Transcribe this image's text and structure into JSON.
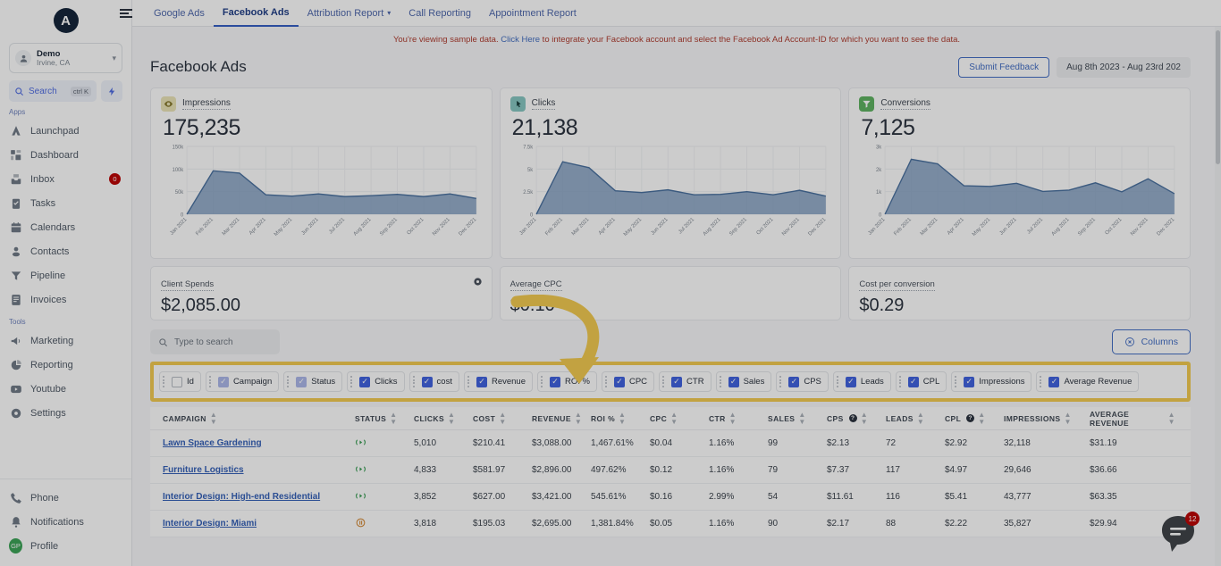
{
  "sidebar": {
    "logo_letter": "A",
    "account": {
      "name": "Demo",
      "location": "Irvine, CA"
    },
    "search": {
      "label": "Search",
      "shortcut": "ctrl K"
    },
    "sections": [
      {
        "label": "Apps",
        "items": [
          {
            "label": "Launchpad",
            "icon": "launchpad-icon",
            "badge": ""
          },
          {
            "label": "Dashboard",
            "icon": "dashboard-icon",
            "badge": ""
          },
          {
            "label": "Inbox",
            "icon": "inbox-icon",
            "badge": "0"
          },
          {
            "label": "Tasks",
            "icon": "tasks-icon",
            "badge": ""
          },
          {
            "label": "Calendars",
            "icon": "calendar-icon",
            "badge": ""
          },
          {
            "label": "Contacts",
            "icon": "contacts-icon",
            "badge": ""
          },
          {
            "label": "Pipeline",
            "icon": "pipeline-icon",
            "badge": ""
          },
          {
            "label": "Invoices",
            "icon": "invoices-icon",
            "badge": ""
          }
        ]
      },
      {
        "label": "Tools",
        "items": [
          {
            "label": "Marketing",
            "icon": "megaphone-icon",
            "badge": ""
          },
          {
            "label": "Reporting",
            "icon": "pie-chart-icon",
            "badge": ""
          },
          {
            "label": "Youtube",
            "icon": "youtube-icon",
            "badge": ""
          },
          {
            "label": "Settings",
            "icon": "gear-icon",
            "badge": ""
          }
        ]
      }
    ],
    "bottom": [
      {
        "label": "Phone",
        "icon": "phone-icon"
      },
      {
        "label": "Notifications",
        "icon": "bell-icon"
      },
      {
        "label": "Profile",
        "icon": "avatar",
        "initials": "GP"
      }
    ]
  },
  "topbar": {
    "tabs": [
      {
        "label": "Google Ads",
        "active": false,
        "caret": false
      },
      {
        "label": "Facebook Ads",
        "active": true,
        "caret": false
      },
      {
        "label": "Attribution Report",
        "active": false,
        "caret": true
      },
      {
        "label": "Call Reporting",
        "active": false,
        "caret": false
      },
      {
        "label": "Appointment Report",
        "active": false,
        "caret": false
      }
    ]
  },
  "notice": {
    "before": "You're viewing sample data. ",
    "link": "Click Here",
    "after": " to integrate your Facebook account and select the Facebook Ad Account-ID for which you want to see the data."
  },
  "header": {
    "title": "Facebook Ads",
    "feedback_label": "Submit Feedback",
    "date_range": "Aug 8th 2023 - Aug 23rd 202"
  },
  "kpis": [
    {
      "label": "Impressions",
      "value": "175,235",
      "icon": "eye-icon",
      "icon_bg": "#ece5b0",
      "icon_color": "#8a7a20"
    },
    {
      "label": "Clicks",
      "value": "21,138",
      "icon": "cursor-click-icon",
      "icon_bg": "#7ec9c3",
      "icon_color": "#14413e"
    },
    {
      "label": "Conversions",
      "value": "7,125",
      "icon": "funnel-icon",
      "icon_bg": "#55b758",
      "icon_color": "#ffffff"
    }
  ],
  "small_cards": [
    {
      "label": "Client Spends",
      "value": "$2,085.00",
      "gear": true
    },
    {
      "label": "Average CPC",
      "value": "$0.10",
      "gear": false
    },
    {
      "label": "Cost per conversion",
      "value": "$0.29",
      "gear": false
    }
  ],
  "toolbar": {
    "search_placeholder": "Type to search",
    "search_value": "",
    "columns_label": "Columns"
  },
  "column_chips": [
    {
      "label": "Id",
      "checked": false,
      "dim": false
    },
    {
      "label": "Campaign",
      "checked": true,
      "dim": true
    },
    {
      "label": "Status",
      "checked": true,
      "dim": true
    },
    {
      "label": "Clicks",
      "checked": true,
      "dim": false
    },
    {
      "label": "cost",
      "checked": true,
      "dim": false
    },
    {
      "label": "Revenue",
      "checked": true,
      "dim": false
    },
    {
      "label": "ROI %",
      "checked": true,
      "dim": false
    },
    {
      "label": "CPC",
      "checked": true,
      "dim": false
    },
    {
      "label": "CTR",
      "checked": true,
      "dim": false
    },
    {
      "label": "Sales",
      "checked": true,
      "dim": false
    },
    {
      "label": "CPS",
      "checked": true,
      "dim": false
    },
    {
      "label": "Leads",
      "checked": true,
      "dim": false
    },
    {
      "label": "CPL",
      "checked": true,
      "dim": false
    },
    {
      "label": "Impressions",
      "checked": true,
      "dim": false
    },
    {
      "label": "Average Revenue",
      "checked": true,
      "dim": false
    }
  ],
  "table": {
    "columns": [
      {
        "label": "CAMPAIGN",
        "help": false
      },
      {
        "label": "STATUS",
        "help": false
      },
      {
        "label": "CLICKS",
        "help": false
      },
      {
        "label": "COST",
        "help": false
      },
      {
        "label": "REVENUE",
        "help": false
      },
      {
        "label": "ROI %",
        "help": false
      },
      {
        "label": "CPC",
        "help": false
      },
      {
        "label": "CTR",
        "help": false
      },
      {
        "label": "SALES",
        "help": false
      },
      {
        "label": "CPS",
        "help": true
      },
      {
        "label": "LEADS",
        "help": false
      },
      {
        "label": "CPL",
        "help": true
      },
      {
        "label": "IMPRESSIONS",
        "help": false
      },
      {
        "label": "AVERAGE REVENUE",
        "help": false
      }
    ],
    "rows": [
      {
        "campaign": "Lawn Space Gardening",
        "status": "active",
        "clicks": "5,010",
        "cost": "$210.41",
        "revenue": "$3,088.00",
        "roi": "1,467.61%",
        "cpc": "$0.04",
        "ctr": "1.16%",
        "sales": "99",
        "cps": "$2.13",
        "leads": "72",
        "cpl": "$2.92",
        "impressions": "32,118",
        "avg_revenue": "$31.19"
      },
      {
        "campaign": "Furniture Logistics",
        "status": "active",
        "clicks": "4,833",
        "cost": "$581.97",
        "revenue": "$2,896.00",
        "roi": "497.62%",
        "cpc": "$0.12",
        "ctr": "1.16%",
        "sales": "79",
        "cps": "$7.37",
        "leads": "117",
        "cpl": "$4.97",
        "impressions": "29,646",
        "avg_revenue": "$36.66"
      },
      {
        "campaign": "Interior Design: High-end Residential",
        "status": "active",
        "clicks": "3,852",
        "cost": "$627.00",
        "revenue": "$3,421.00",
        "roi": "545.61%",
        "cpc": "$0.16",
        "ctr": "2.99%",
        "sales": "54",
        "cps": "$11.61",
        "leads": "116",
        "cpl": "$5.41",
        "impressions": "43,777",
        "avg_revenue": "$63.35"
      },
      {
        "campaign": "Interior Design: Miami",
        "status": "paused",
        "clicks": "3,818",
        "cost": "$195.03",
        "revenue": "$2,695.00",
        "roi": "1,381.84%",
        "cpc": "$0.05",
        "ctr": "1.16%",
        "sales": "90",
        "cps": "$2.17",
        "leads": "88",
        "cpl": "$2.22",
        "impressions": "35,827",
        "avg_revenue": "$29.94"
      }
    ]
  },
  "chat": {
    "badge": "12"
  },
  "chart_data": [
    {
      "type": "area",
      "title": "Impressions",
      "x": [
        "Jan 2021",
        "Feb 2021",
        "Mar 2021",
        "Apr 2021",
        "May 2021",
        "Jun 2021",
        "Jul 2021",
        "Aug 2021",
        "Sep 2021",
        "Oct 2021",
        "Nov 2021",
        "Dec 2021"
      ],
      "values": [
        0,
        96000,
        91000,
        43000,
        40000,
        45000,
        39000,
        41000,
        44000,
        39000,
        45000,
        35000
      ],
      "ylim": [
        0,
        150000
      ],
      "yticks": [
        0,
        50000,
        100000,
        150000
      ],
      "ytick_labels": [
        "0",
        "50k",
        "100k",
        "150k"
      ],
      "xlabel": "",
      "ylabel": "",
      "grid": true,
      "legend": "none",
      "line_color": "#4472a8",
      "fill_color": "#7a9cc6"
    },
    {
      "type": "area",
      "title": "Clicks",
      "x": [
        "Jan 2021",
        "Feb 2021",
        "Mar 2021",
        "Apr 2021",
        "May 2021",
        "Jun 2021",
        "Jul 2021",
        "Aug 2021",
        "Sep 2021",
        "Oct 2021",
        "Nov 2021",
        "Dec 2021"
      ],
      "values": [
        0,
        5800,
        5150,
        2600,
        2400,
        2700,
        2150,
        2200,
        2500,
        2150,
        2650,
        2000
      ],
      "ylim": [
        0,
        7500
      ],
      "yticks": [
        0,
        2500,
        5000,
        7500
      ],
      "ytick_labels": [
        "0",
        "2.5k",
        "5k",
        "7.5k"
      ],
      "xlabel": "",
      "ylabel": "",
      "grid": true,
      "legend": "none",
      "line_color": "#4472a8",
      "fill_color": "#7a9cc6"
    },
    {
      "type": "area",
      "title": "Conversions",
      "x": [
        "Jan 2021",
        "Feb 2021",
        "Mar 2021",
        "Apr 2021",
        "May 2021",
        "Jun 2021",
        "Jul 2021",
        "Aug 2021",
        "Sep 2021",
        "Oct 2021",
        "Nov 2021",
        "Dec 2021"
      ],
      "values": [
        0,
        2430,
        2230,
        1260,
        1230,
        1370,
        1010,
        1070,
        1390,
        990,
        1570,
        910
      ],
      "ylim": [
        0,
        3000
      ],
      "yticks": [
        0,
        1000,
        2000,
        3000
      ],
      "ytick_labels": [
        "0",
        "1k",
        "2k",
        "3k"
      ],
      "xlabel": "",
      "ylabel": "",
      "grid": true,
      "legend": "none",
      "line_color": "#4472a8",
      "fill_color": "#7a9cc6"
    }
  ]
}
